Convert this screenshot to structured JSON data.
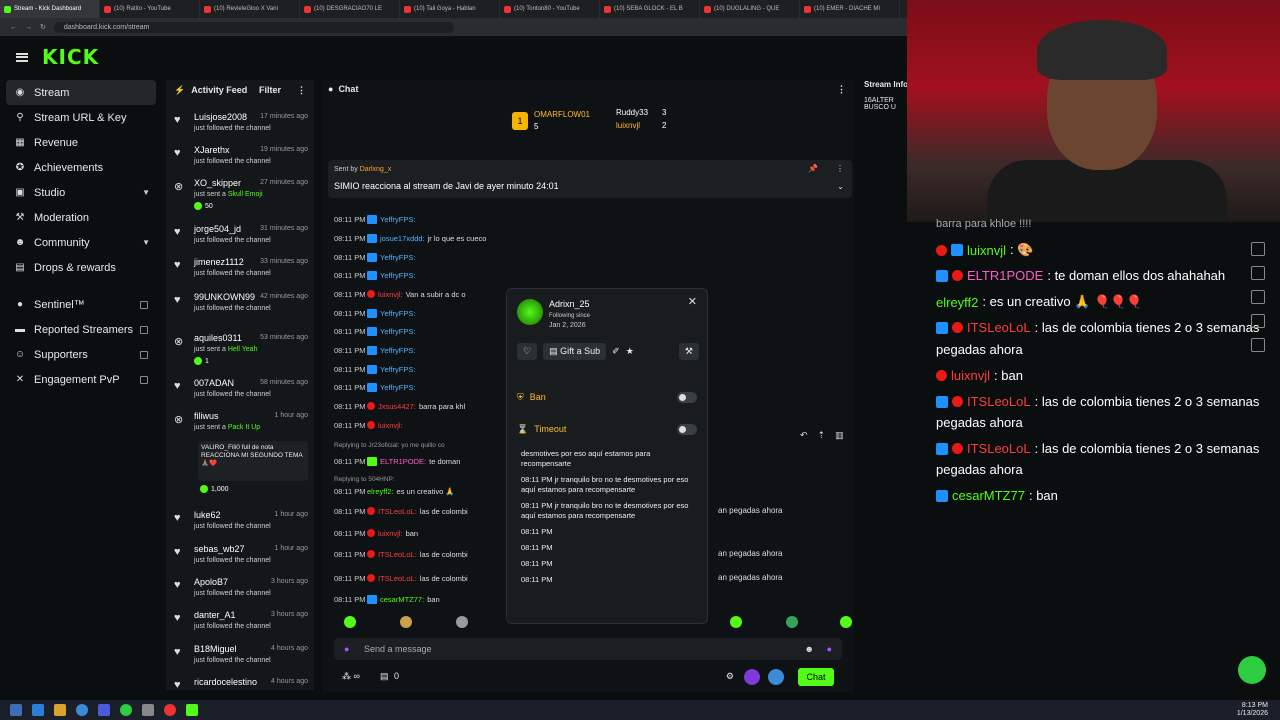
{
  "browser": {
    "tabs": [
      {
        "label": "Stream - Kick Dashboard"
      },
      {
        "label": "(10) Ratito - YouTube"
      },
      {
        "label": "(10) RevieleGloo X Vani"
      },
      {
        "label": "(10) DESGRACIAO70 LE"
      },
      {
        "label": "(10) Tali Goya - Hablan"
      },
      {
        "label": "(10) Tonton80 - YouTube"
      },
      {
        "label": "(10) SEBA GLOCK - EL B"
      },
      {
        "label": "(10) DUGLALING - QUE"
      },
      {
        "label": "(10) EMER - DIACHE MI"
      }
    ],
    "url": "dashboard.kick.com/stream"
  },
  "header": {
    "logo": "KICK"
  },
  "sidebar": {
    "items": [
      {
        "label": "Stream"
      },
      {
        "label": "Stream URL & Key"
      },
      {
        "label": "Revenue"
      },
      {
        "label": "Achievements"
      },
      {
        "label": "Studio"
      },
      {
        "label": "Moderation"
      },
      {
        "label": "Community"
      },
      {
        "label": "Drops & rewards"
      },
      {
        "label": "Sentinel™"
      },
      {
        "label": "Reported Streamers"
      },
      {
        "label": "Supporters"
      },
      {
        "label": "Engagement PvP"
      }
    ]
  },
  "activity": {
    "title": "Activity Feed",
    "filter": "Filter",
    "items": [
      {
        "name": "Luisjose2008",
        "time": "17 minutes ago",
        "desc": "just followed the channel"
      },
      {
        "name": "XJarethx",
        "time": "19 minutes ago",
        "desc": "just followed the channel"
      },
      {
        "name": "XO_skipper",
        "time": "27 minutes ago",
        "desc": "just sent a",
        "gift": "Skull Emoji",
        "amount": "50"
      },
      {
        "name": "jorge504_jd",
        "time": "31 minutes ago",
        "desc": "just followed the channel"
      },
      {
        "name": "jimenez1112",
        "time": "33 minutes ago",
        "desc": "just followed the channel"
      },
      {
        "name": "99UNKOWN99",
        "time": "42 minutes ago",
        "desc": "just followed the channel"
      },
      {
        "name": "aquiles0311",
        "time": "53 minutes ago",
        "desc": "just sent a",
        "gift": "Hell Yeah",
        "amount": "1"
      },
      {
        "name": "007ADAN",
        "time": "58 minutes ago",
        "desc": "just followed the channel"
      },
      {
        "name": "filiwus",
        "time": "1 hour ago",
        "desc": "just sent a",
        "gift": "Pack It Up",
        "message": "VALIRO_Fili0 full de nota REACCIONA MI SEGUNDO TEMA 🙏🏽❤️",
        "amount": "1,000"
      },
      {
        "name": "luke62",
        "time": "1 hour ago",
        "desc": "just followed the channel"
      },
      {
        "name": "sebas_wb27",
        "time": "1 hour ago",
        "desc": "just followed the channel"
      },
      {
        "name": "ApoloB7",
        "time": "3 hours ago",
        "desc": "just followed the channel"
      },
      {
        "name": "danter_A1",
        "time": "3 hours ago",
        "desc": "just followed the channel"
      },
      {
        "name": "B18Miguel",
        "time": "4 hours ago",
        "desc": "just followed the channel"
      },
      {
        "name": "ricardocelestino",
        "time": "4 hours ago",
        "desc": ""
      }
    ]
  },
  "chat": {
    "title": "Chat",
    "leaderboard": [
      {
        "rank": "1",
        "name": "OMARFLOW01",
        "count": "5"
      },
      {
        "name": "Ruddy33",
        "count": "3"
      },
      {
        "name": "luixnvjl",
        "count": "2"
      }
    ],
    "pinned": {
      "by_label": "Sent by",
      "by_user": "Darlxng_x",
      "text": "SIMIO reacciona al stream de Javi de ayer minuto 24:01"
    },
    "messages": [
      {
        "time": "08:11 PM",
        "user": "YeffryFPS:",
        "text": ""
      },
      {
        "time": "08:11 PM",
        "user": "josue17xddd:",
        "text": "jr lo que es cueco"
      },
      {
        "time": "08:11 PM",
        "user": "YeffryFPS:",
        "text": ""
      },
      {
        "time": "08:11 PM",
        "user": "YeffryFPS:",
        "text": ""
      },
      {
        "time": "08:11 PM",
        "user": "luixnvjl:",
        "text": "Van a subir a dc o"
      },
      {
        "time": "08:11 PM",
        "user": "YeffryFPS:",
        "text": ""
      },
      {
        "time": "08:11 PM",
        "user": "YeffryFPS:",
        "text": ""
      },
      {
        "time": "08:11 PM",
        "user": "YeffryFPS:",
        "text": ""
      },
      {
        "time": "08:11 PM",
        "user": "YeffryFPS:",
        "text": ""
      },
      {
        "time": "08:11 PM",
        "user": "YeffryFPS:",
        "text": ""
      },
      {
        "time": "08:11 PM",
        "user": "Jxsus4427:",
        "text": "barra para khl"
      },
      {
        "time": "08:11 PM",
        "user": "luixnvjl:",
        "text": ""
      }
    ],
    "reply1": "Replying to Jr23oficial: yo me quillo co",
    "msg_eltr": {
      "time": "08:11 PM",
      "user": "ELTR1PODE:",
      "text": "te doman"
    },
    "reply2": "Replying to 504HNP:",
    "msg_elrey": {
      "time": "08:11 PM",
      "user": "elreyff2:",
      "text": "es un creativo 🙏"
    },
    "tail": [
      {
        "time": "08:11 PM",
        "user": "ITSLeoLoL:",
        "text": "las de colombi",
        "rest": "an pegadas ahora"
      },
      {
        "time": "08:11 PM",
        "user": "luixnvjl:",
        "text": "ban",
        "rest": ""
      },
      {
        "time": "08:11 PM",
        "user": "ITSLeoLoL:",
        "text": "las de colombi",
        "rest": "an pegadas ahora"
      },
      {
        "time": "08:11 PM",
        "user": "ITSLeoLoL:",
        "text": "las de colombi",
        "rest": "an pegadas ahora"
      },
      {
        "time": "08:11 PM",
        "user": "cesarMTZ77:",
        "text": "ban",
        "rest": ""
      }
    ],
    "placeholder": "Send a message",
    "viewers": "0",
    "send": "Chat"
  },
  "popup": {
    "name": "Adrixn_25",
    "following_label": "Following since",
    "following_date": "Jan 2, 2026",
    "gift": "Gift a Sub",
    "ban": "Ban",
    "timeout": "Timeout",
    "messages": [
      "desmotives por eso aquí estamos para recompensarte",
      "08:11 PM jr tranquilo bro no te desmotives por eso aquí estamos para recompensarte",
      "08:11 PM jr tranquilo bro no te desmotives por eso aquí estamos para recompensarte",
      "08:11 PM",
      "08:11 PM",
      "08:11 PM",
      "08:11 PM"
    ]
  },
  "info": {
    "title": "Stream Info",
    "l1": "16ALTER",
    "l2": "BUSCO U"
  },
  "overlay": {
    "top": "barra para khloe !!!!",
    "lines": [
      {
        "user": "luixnvjl",
        "text": ": 🎨"
      },
      {
        "user": "ELTR1PODE",
        "text": ": te doman ellos dos ahahahah"
      },
      {
        "user": "elreyff2",
        "text": ": es un creativo 🙏 🎈🎈🎈"
      },
      {
        "user": "ITSLeoLoL",
        "text": ": las de colombia tienes 2 o 3 semanas"
      },
      {
        "user": "luixnvjl",
        "text": ": ban"
      },
      {
        "user": "ITSLeoLoL",
        "text": ": las de colombia tienes 2 o 3 semanas"
      },
      {
        "user": "ITSLeoLoL",
        "text": ": las de colombia tienes 2 o 3 semanas"
      },
      {
        "user": "cesarMTZ77",
        "text": ": ban"
      }
    ],
    "wrap": "pegadas ahora"
  },
  "clock": {
    "time": "8:13 PM",
    "date": "1/13/2026"
  }
}
